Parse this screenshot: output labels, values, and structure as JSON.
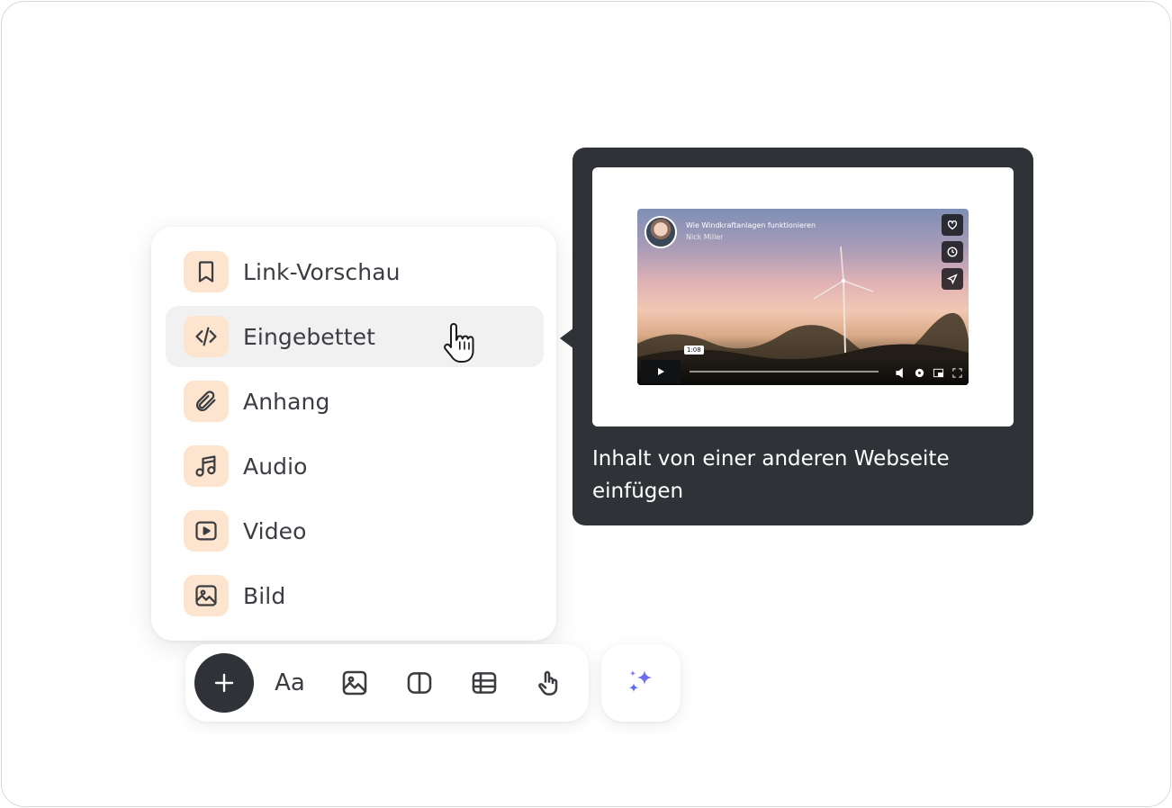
{
  "menu": {
    "items": [
      {
        "label": "Link-Vorschau",
        "icon": "bookmark-icon"
      },
      {
        "label": "Eingebettet",
        "icon": "code-icon",
        "hovered": true
      },
      {
        "label": "Anhang",
        "icon": "paperclip-icon"
      },
      {
        "label": "Audio",
        "icon": "music-note-icon"
      },
      {
        "label": "Video",
        "icon": "play-video-icon"
      },
      {
        "label": "Bild",
        "icon": "image-icon"
      }
    ]
  },
  "tooltip": {
    "description": "Inhalt von einer anderen Webseite einfügen",
    "preview": {
      "video_title": "Wie Windkraftanlagen funktionieren",
      "video_author": "Nick Miller",
      "time_badge": "1:08"
    }
  },
  "toolbar": {
    "text_tool_label": "Aa",
    "tools": [
      "plus-icon",
      "text-style-icon",
      "image-icon",
      "columns-icon",
      "table-icon",
      "hand-pointer-icon"
    ],
    "ai_tool": "sparkles-icon"
  },
  "colors": {
    "accent_icon_bg": "#fde4cf",
    "tooltip_bg": "#2f3337",
    "sparkle": "#6b6cf0"
  }
}
